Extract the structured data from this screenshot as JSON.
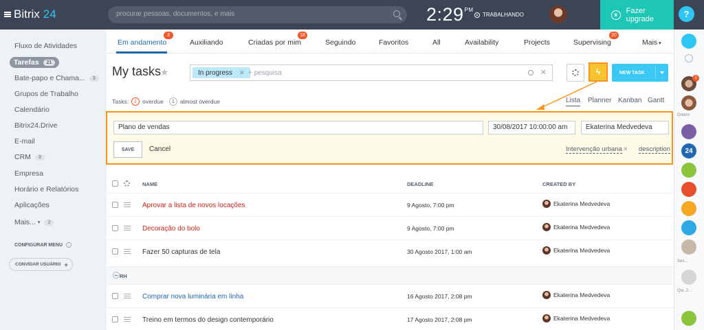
{
  "app": {
    "name": "Bitrix",
    "version": "24"
  },
  "search": {
    "placeholder": "procurar pessoas, documentos, e mais"
  },
  "clock": {
    "time": "2:29",
    "ampm": "PM",
    "status": "TRABALHANDO"
  },
  "upgrade": {
    "label": "Fazer upgrade"
  },
  "help": {
    "label": "?"
  },
  "sidebar": {
    "items": [
      {
        "label": "Fluxo de Atividades"
      },
      {
        "label": "Tarefas",
        "count": "21"
      },
      {
        "label": "Bate-papo e Chama...",
        "count": "3"
      },
      {
        "label": "Grupos de Trabalho"
      },
      {
        "label": "Calendário"
      },
      {
        "label": "Bitrix24.Drive"
      },
      {
        "label": "E-mail"
      },
      {
        "label": "CRM",
        "count": "3"
      },
      {
        "label": "Empresa"
      },
      {
        "label": "Horário e Relatórios"
      },
      {
        "label": "Aplicações"
      },
      {
        "label": "Mais...",
        "count": "2"
      }
    ],
    "config_menu": "CONFIGURAR MENU",
    "invite": "CONVIDAR USUÁRIO"
  },
  "tabs": [
    {
      "label": "Em andamento",
      "badge": "3"
    },
    {
      "label": "Auxiliando"
    },
    {
      "label": "Criadas por mim",
      "badge": "18"
    },
    {
      "label": "Seguindo"
    },
    {
      "label": "Favoritos"
    },
    {
      "label": "All"
    },
    {
      "label": "Availability"
    },
    {
      "label": "Projects"
    },
    {
      "label": "Supervising",
      "badge": "20"
    },
    {
      "label": "Mais"
    }
  ],
  "page": {
    "title": "My tasks"
  },
  "filter": {
    "chip": "In progress",
    "placeholder": "+ pesquisa"
  },
  "toolbar": {
    "new_task": "NEW TASK"
  },
  "counters": {
    "prefix": "Tasks:",
    "overdue_count": "2",
    "overdue_label": "overdue",
    "almost_count": "1",
    "almost_label": "almost overdue"
  },
  "views": [
    "Lista",
    "Planner",
    "Kanban",
    "Gantt"
  ],
  "quick_add": {
    "title": "Plano de vendas",
    "deadline": "30/08/2017 10:00:00 am",
    "responsible": "Ekaterina Medvedeva",
    "save": "SAVE",
    "cancel": "Cancel",
    "project": "Intervenção urbana",
    "description": "description"
  },
  "grid": {
    "columns": {
      "name": "NAME",
      "deadline": "DEADLINE",
      "created_by": "CREATED BY"
    },
    "rows": [
      {
        "name": "Aprovar a lista de novos locações",
        "deadline": "9 Agosto, 7:00 pm",
        "created_by": "Ekaterina Medvedeva"
      },
      {
        "name": "Decoração do bolo",
        "deadline": "9 Agosto, 7:00 pm",
        "created_by": "Ekaterina Medvedeva"
      },
      {
        "name": "Fazer 50 capturas de tela",
        "deadline": "30 Agosto 2017, 1:00 am",
        "created_by": "Ekaterina Medvedeva"
      },
      {
        "name": "Comprar nova luminária em linha",
        "deadline": "16 Agosto 2017, 2:08 pm",
        "created_by": "Ekaterina Medvedeva"
      },
      {
        "name": "Treino em termos do design contemporário",
        "deadline": "17 Agosto 2017, 2:08 pm",
        "created_by": "Ekaterina Medvedeva"
      }
    ],
    "group": "RH"
  },
  "rail": {
    "badge": "3",
    "label_yesterday": "Ontem",
    "label_24": "24",
    "label_sex": "Sex...",
    "label_qui": "Qui, 2..."
  },
  "colors": {
    "topbar": "#3c4555",
    "accent": "#2067b0",
    "overdue": "#d0231d",
    "link_blue": "#2067b0",
    "highlight": "#f7941d",
    "button": "#3bc8f5"
  }
}
